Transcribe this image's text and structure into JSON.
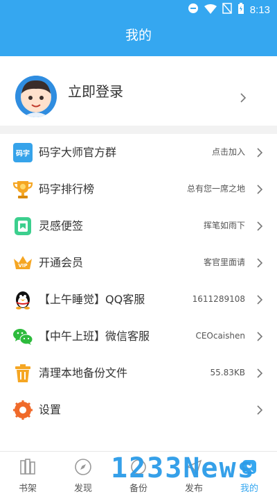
{
  "status_bar": {
    "time": "8:13"
  },
  "header": {
    "title": "我的"
  },
  "profile": {
    "login_label": "立即登录"
  },
  "menu": [
    {
      "icon": "mazi-group-icon",
      "label": "码字大师官方群",
      "hint": "点击加入"
    },
    {
      "icon": "trophy-icon",
      "label": "码字排行榜",
      "hint": "总有您一席之地"
    },
    {
      "icon": "notes-icon",
      "label": "灵感便签",
      "hint": "挥笔如雨下"
    },
    {
      "icon": "vip-crown-icon",
      "label": "开通会员",
      "hint": "客官里面请"
    },
    {
      "icon": "qq-penguin-icon",
      "label": "【上午睡觉】QQ客服",
      "hint": "1611289108"
    },
    {
      "icon": "wechat-icon",
      "label": "【中午上班】微信客服",
      "hint": "CEOcaishen"
    },
    {
      "icon": "trash-icon",
      "label": "清理本地备份文件",
      "hint": "55.83KB"
    },
    {
      "icon": "settings-gear-icon",
      "label": "设置",
      "hint": ""
    }
  ],
  "tabs": [
    {
      "icon": "bookshelf-icon",
      "label": "书架"
    },
    {
      "icon": "compass-icon",
      "label": "发现"
    },
    {
      "icon": "backup-icon",
      "label": "备份"
    },
    {
      "icon": "publish-icon",
      "label": "发布"
    },
    {
      "icon": "profile-icon",
      "label": "我的"
    }
  ],
  "watermark": "1233News",
  "colors": {
    "accent": "#35a7f0",
    "divider": "#f2f2f2",
    "text": "#333333"
  }
}
